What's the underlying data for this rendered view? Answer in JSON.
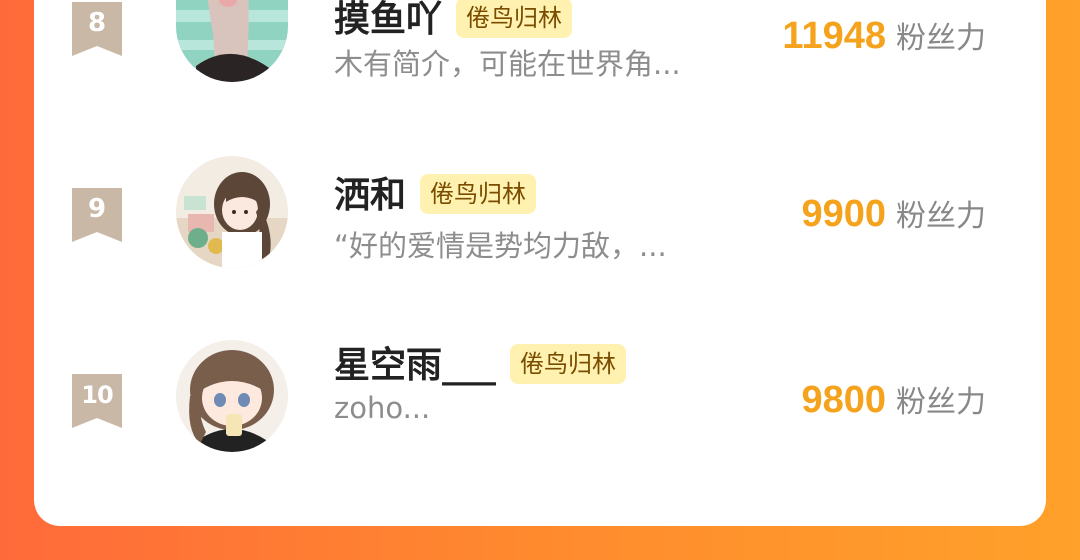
{
  "ranking": {
    "rows": [
      {
        "rank": "8",
        "name": "摸鱼吖",
        "tag": "倦鸟归林",
        "bio": "木有简介，可能在世界角...",
        "fans_count": "11948",
        "fans_unit": "粉丝力",
        "avatar_icon": "cat-paw-avatar"
      },
      {
        "rank": "9",
        "name": "洒和",
        "tag": "倦鸟归林",
        "bio": "“好的爱情是势均力敌，...",
        "fans_count": "9900",
        "fans_unit": "粉丝力",
        "avatar_icon": "anime-girl-avatar"
      },
      {
        "rank": "10",
        "name": "星空雨___",
        "tag": "倦鸟归林",
        "bio": "zoho...",
        "fans_count": "9800",
        "fans_unit": "粉丝力",
        "avatar_icon": "chibi-girl-avatar"
      }
    ]
  },
  "colors": {
    "background_gradient_start": "#ff6a3a",
    "background_gradient_end": "#ffa12a",
    "fans_count": "#f5a31c",
    "tag_background": "#fff2b0",
    "rank_badge": "#c9b8a6"
  }
}
